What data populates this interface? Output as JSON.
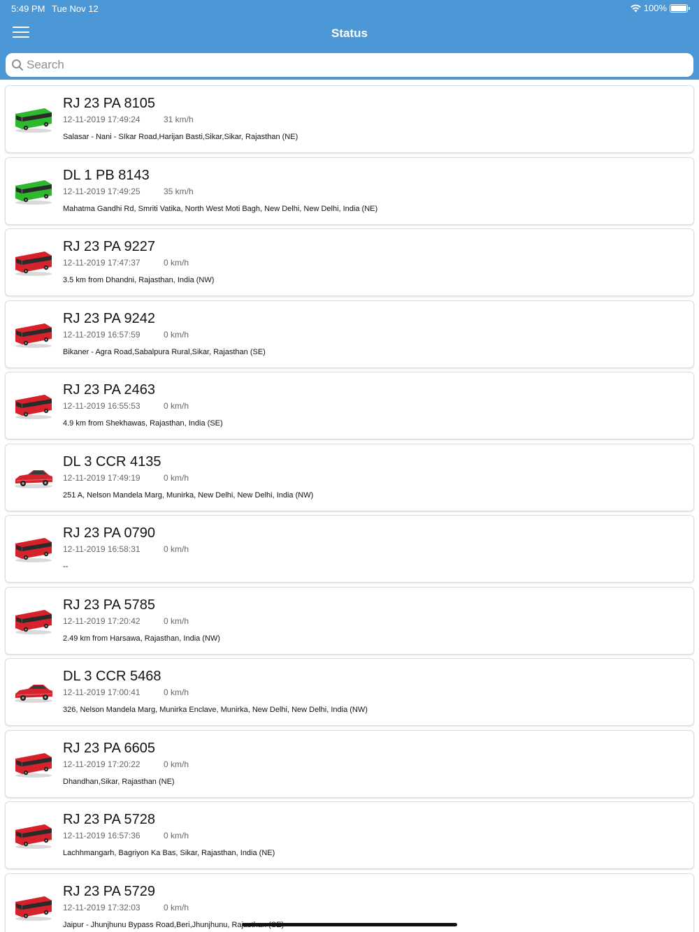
{
  "status_bar": {
    "time": "5:49 PM",
    "date": "Tue Nov 12",
    "battery": "100%"
  },
  "navbar": {
    "title": "Status"
  },
  "search": {
    "placeholder": "Search"
  },
  "colors": {
    "header": "#4c97d6",
    "moving": "#2eb82e",
    "stopped": "#d6222c"
  },
  "vehicles": [
    {
      "plate": "RJ 23 PA 8105",
      "time": "12-11-2019 17:49:24",
      "speed": "31 km/h",
      "address": "Salasar - Nani - SIkar Road,Harijan Basti,Sikar,Sikar, Rajasthan (NE)",
      "type": "bus",
      "state": "moving"
    },
    {
      "plate": "DL 1 PB 8143",
      "time": "12-11-2019 17:49:25",
      "speed": "35 km/h",
      "address": "Mahatma Gandhi Rd, Smriti Vatika, North West Moti Bagh, New Delhi, New Delhi,  India (NE)",
      "type": "bus",
      "state": "moving"
    },
    {
      "plate": "RJ 23 PA 9227",
      "time": "12-11-2019 17:47:37",
      "speed": "0 km/h",
      "address": "3.5 km from Dhandni, Rajasthan, India (NW)",
      "type": "bus",
      "state": "stopped"
    },
    {
      "plate": "RJ 23 PA 9242",
      "time": "12-11-2019 16:57:59",
      "speed": "0 km/h",
      "address": "Bikaner - Agra Road,Sabalpura Rural,Sikar, Rajasthan (SE)",
      "type": "bus",
      "state": "stopped"
    },
    {
      "plate": "RJ 23 PA 2463",
      "time": "12-11-2019 16:55:53",
      "speed": "0 km/h",
      "address": "4.9 km from Shekhawas, Rajasthan, India (SE)",
      "type": "bus",
      "state": "stopped"
    },
    {
      "plate": "DL 3 CCR 4135",
      "time": "12-11-2019 17:49:19",
      "speed": "0 km/h",
      "address": "251 A, Nelson Mandela Marg, Munirka, New Delhi, New Delhi,  India (NW)",
      "type": "car",
      "state": "stopped"
    },
    {
      "plate": "RJ 23 PA 0790",
      "time": "12-11-2019 16:58:31",
      "speed": "0 km/h",
      "address": "--",
      "type": "bus",
      "state": "stopped"
    },
    {
      "plate": "RJ 23 PA 5785",
      "time": "12-11-2019 17:20:42",
      "speed": "0 km/h",
      "address": "2.49 km from Harsawa, Rajasthan, India (NW)",
      "type": "bus",
      "state": "stopped"
    },
    {
      "plate": "DL 3 CCR 5468",
      "time": "12-11-2019 17:00:41",
      "speed": "0 km/h",
      "address": "326, Nelson Mandela Marg, Munirka Enclave, Munirka, New Delhi, New Delhi,  India (NW)",
      "type": "car",
      "state": "stopped"
    },
    {
      "plate": "RJ 23 PA 6605",
      "time": "12-11-2019 17:20:22",
      "speed": "0 km/h",
      "address": "Dhandhan,Sikar, Rajasthan (NE)",
      "type": "bus",
      "state": "stopped"
    },
    {
      "plate": "RJ 23 PA 5728",
      "time": "12-11-2019 16:57:36",
      "speed": "0 km/h",
      "address": "Lachhmangarh, Bagriyon Ka Bas, Sikar, Rajasthan, India (NE)",
      "type": "bus",
      "state": "stopped"
    },
    {
      "plate": "RJ 23 PA 5729",
      "time": "12-11-2019 17:32:03",
      "speed": "0 km/h",
      "address": "Jaipur - Jhunjhunu Bypass Road,Beri,Jhunjhunu, Rajasthan (SE)",
      "type": "bus",
      "state": "stopped"
    }
  ]
}
